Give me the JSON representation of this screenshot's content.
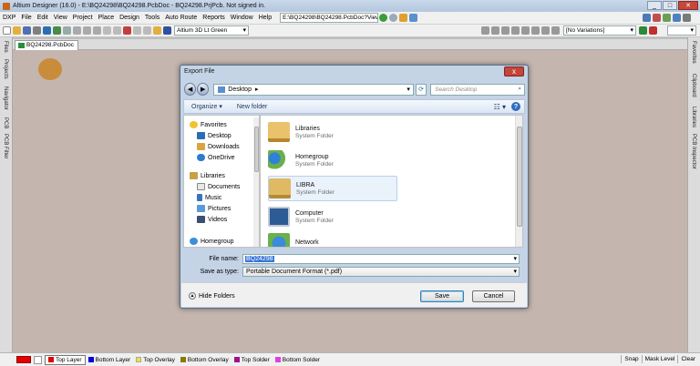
{
  "window": {
    "title": "Altium Designer (16.0) - E:\\BQ24298\\BQ24298.PcbDoc - BQ24298.PrjPcb. Not signed in."
  },
  "menu": {
    "items": [
      "DXP",
      "File",
      "Edit",
      "View",
      "Project",
      "Place",
      "Design",
      "Tools",
      "Auto Route",
      "Reports",
      "Window",
      "Help"
    ],
    "path_value": "E:\\BQ24298\\BQ24298.PcbDoc?View"
  },
  "toolbar": {
    "view_combo": "Altium 3D Lt Green",
    "variant_combo": "[No Variations]"
  },
  "doc_tab": {
    "label": "BQ24298.PcbDoc"
  },
  "left_panels": [
    "Files",
    "Projects",
    "Navigator",
    "PCB",
    "PCB Filter"
  ],
  "right_panels": [
    "Favorites",
    "Clipboard",
    "Libraries",
    "PCB Inspector"
  ],
  "dialog": {
    "title": "Export File",
    "close_label": "x",
    "address": "Desktop",
    "search_placeholder": "Search Desktop",
    "commands": {
      "organize": "Organize ▾",
      "new_folder": "New folder"
    },
    "nav": {
      "favorites": "Favorites",
      "desktop": "Desktop",
      "downloads": "Downloads",
      "onedrive": "OneDrive",
      "libraries": "Libraries",
      "documents": "Documents",
      "music": "Music",
      "pictures": "Pictures",
      "videos": "Videos",
      "homegroup": "Homegroup"
    },
    "files": [
      {
        "name": "Libraries",
        "type": "System Folder"
      },
      {
        "name": "Homegroup",
        "type": "System Folder"
      },
      {
        "name": "LIBRA",
        "type": "System Folder"
      },
      {
        "name": "Computer",
        "type": "System Folder"
      },
      {
        "name": "Network",
        "type": ""
      }
    ],
    "file_name_label": "File name:",
    "file_name_value": "BQ24298",
    "save_as_type_label": "Save as type:",
    "save_as_type_value": "Portable Document Format (*.pdf)",
    "hide_folders": "Hide Folders",
    "save_button": "Save",
    "cancel_button": "Cancel"
  },
  "layers": {
    "items": [
      {
        "label": "Top Layer",
        "color": "#e00000"
      },
      {
        "label": "Bottom Layer",
        "color": "#0000e0"
      },
      {
        "label": "Top Overlay",
        "color": "#f0e040"
      },
      {
        "label": "Bottom Overlay",
        "color": "#8a7a00"
      },
      {
        "label": "Top Solder",
        "color": "#a01090"
      },
      {
        "label": "Bottom Solder",
        "color": "#e040e0"
      }
    ],
    "status": [
      "Snap",
      "Mask Level",
      "Clear"
    ]
  },
  "colors": {
    "canvas": "#c4b6ae",
    "dialog_frame": "#c4d3e6",
    "accent": "#3875d7"
  }
}
